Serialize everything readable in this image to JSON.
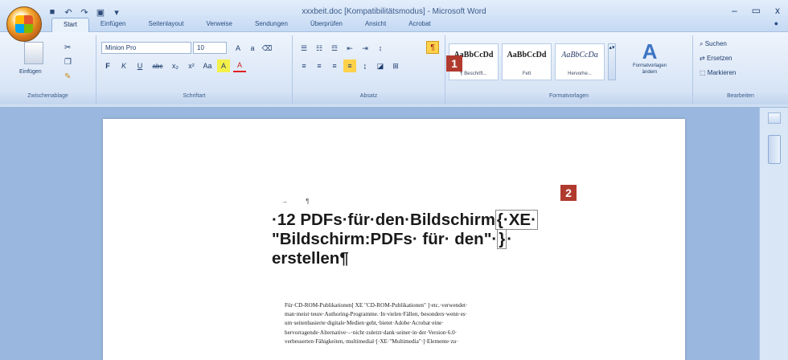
{
  "window": {
    "title": "xxxbeit.doc [Kompatibilitätsmodus] - Microsoft Word",
    "controls": [
      "–",
      "▭",
      "x"
    ]
  },
  "quick_access": [
    "save-icon",
    "undo-icon",
    "redo-icon",
    "print-icon",
    "dropdown-icon"
  ],
  "tabs": [
    "Start",
    "Einfügen",
    "Seitenlayout",
    "Verweise",
    "Sendungen",
    "Überprüfen",
    "Ansicht",
    "Acrobat"
  ],
  "active_tab": "Start",
  "ribbon": {
    "clipboard": {
      "paste_label": "Einfügen",
      "group_label": "Zwischenablage"
    },
    "font": {
      "font_name": "Minion Pro",
      "font_size": "10",
      "group_label": "Schriftart",
      "buttons": [
        "F",
        "K",
        "U",
        "abc",
        "x₂",
        "x²",
        "Aa",
        "A",
        "A"
      ]
    },
    "paragraph": {
      "group_label": "Absatz",
      "show_marks_symbol": "¶"
    },
    "styles": {
      "group_label": "Formatvorlagen",
      "cards": [
        {
          "sample": "AaBbCcDd",
          "name": "¶ Beschrift..."
        },
        {
          "sample": "AaBbCcDd",
          "name": "Fett"
        },
        {
          "sample": "AaBbCcDa",
          "name": "Hervorhe..."
        }
      ],
      "change_styles_label": "Formatvorlagen ändern"
    },
    "editing": {
      "group_label": "Bearbeiten",
      "items": [
        "Suchen",
        "Ersetzen",
        "Markieren"
      ]
    }
  },
  "badges": {
    "one": "1",
    "two": "2"
  },
  "document": {
    "marks": "→ ¶",
    "heading_line1_a": "·12 PDFs·für·den·Bildschirm",
    "heading_field1": "{·XE·",
    "heading_line2_a": "\"Bildschirm:PDFs· für· den\"·",
    "heading_field2": "}",
    "heading_line2_b": "·",
    "heading_line3": "erstellen¶",
    "body_lines": [
      "Für·CD-ROM-Publikationen[ XE \"CD-ROM-Publikationen\" ]·etc.·verwendet·",
      "man·meist·teure·Authoring-Programme.·In·vielen·Fällen,·besonders·wenn·es·",
      "um·seitenbasierte·digitale·Medien·geht,·bietet·Adobe·Acrobat·eine·",
      "hervorragende·Alternative·–·nicht·zuletzt·dank·seiner·in·der·Version·6.0·",
      "verbesserten·Fähigkeiten,·multimedial·[·XE·\"Multimedia\"·]·Elemente·zu·"
    ]
  },
  "colors": {
    "badge": "#b03a2e",
    "ribbon": "#dde8f7",
    "workspace": "#9ab8df"
  }
}
